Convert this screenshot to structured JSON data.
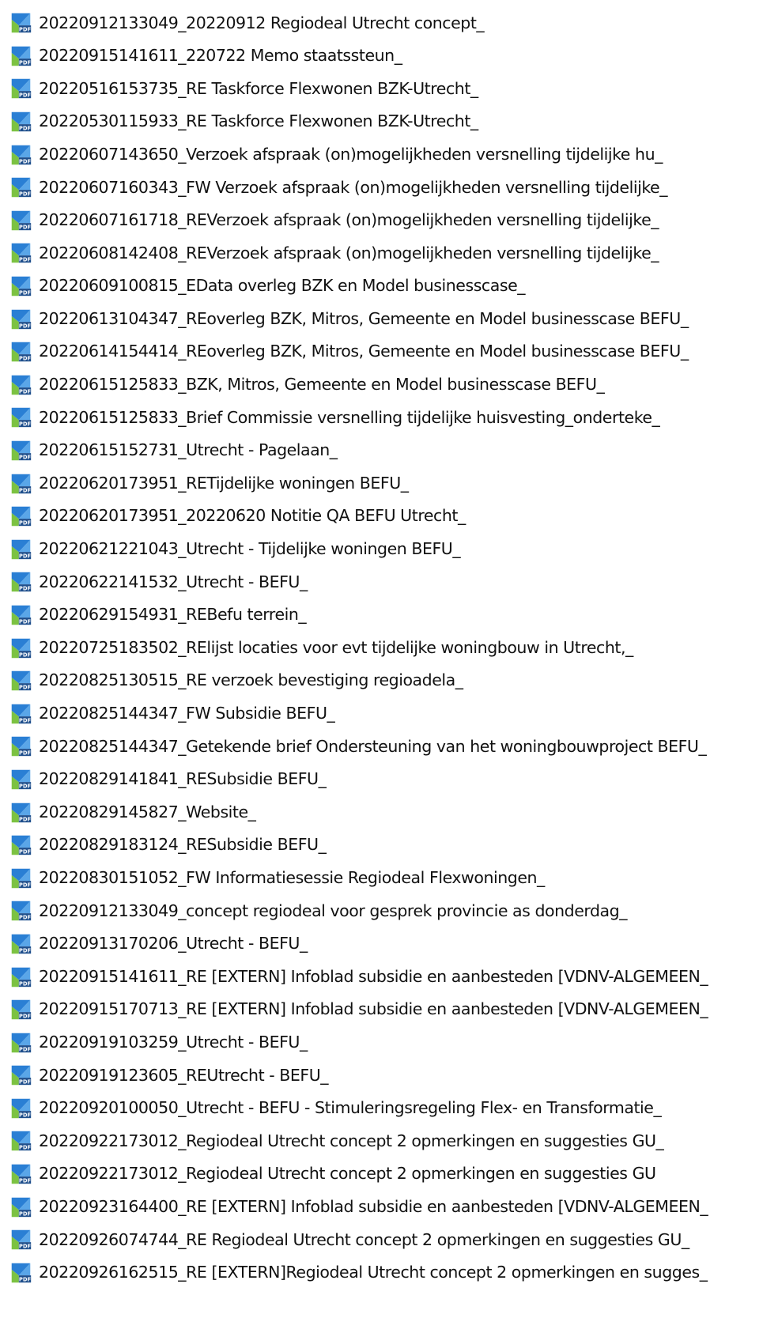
{
  "colors": {
    "icon_blue": "#2a7fd4",
    "icon_green": "#7cc242",
    "icon_dark": "#1f4f8c",
    "text": "#111111",
    "background": "#ffffff"
  },
  "file_icon": "pdf-file-icon",
  "icon_badge_text": "PDF",
  "files": [
    "20220912133049_20220912 Regiodeal Utrecht concept_",
    "20220915141611_220722 Memo staatssteun_",
    "20220516153735_RE Taskforce Flexwonen BZK-Utrecht_",
    "20220530115933_RE Taskforce Flexwonen BZK-Utrecht_",
    "20220607143650_Verzoek afspraak (on)mogelijkheden versnelling tijdelijke hu_",
    "20220607160343_FW Verzoek afspraak (on)mogelijkheden versnelling tijdelijke_",
    "20220607161718_REVerzoek afspraak (on)mogelijkheden versnelling tijdelijke_",
    "20220608142408_REVerzoek afspraak (on)mogelijkheden versnelling tijdelijke_",
    "20220609100815_EData overleg BZK en Model businesscase_",
    "20220613104347_REoverleg BZK, Mitros, Gemeente en Model businesscase BEFU_",
    "20220614154414_REoverleg BZK, Mitros, Gemeente en Model businesscase BEFU_",
    "20220615125833_BZK, Mitros, Gemeente en Model businesscase BEFU_",
    "20220615125833_Brief Commissie versnelling tijdelijke huisvesting_onderteke_",
    "20220615152731_Utrecht - Pagelaan_",
    "20220620173951_RETijdelijke woningen BEFU_",
    "20220620173951_20220620 Notitie QA BEFU Utrecht_",
    "20220621221043_Utrecht - Tijdelijke woningen BEFU_",
    "20220622141532_Utrecht - BEFU_",
    "20220629154931_REBefu terrein_",
    "20220725183502_RElijst locaties voor evt tijdelijke woningbouw in Utrecht,_",
    "20220825130515_RE verzoek bevestiging regioadela_",
    "20220825144347_FW Subsidie BEFU_",
    "20220825144347_Getekende brief Ondersteuning van het woningbouwproject BEFU_",
    "20220829141841_RESubsidie BEFU_",
    "20220829145827_Website_",
    "20220829183124_RESubsidie BEFU_",
    "20220830151052_FW Informatiesessie Regiodeal Flexwoningen_",
    "20220912133049_concept regiodeal voor gesprek provincie as donderdag_",
    "20220913170206_Utrecht - BEFU_",
    "20220915141611_RE [EXTERN] Infoblad subsidie en aanbesteden [VDNV-ALGEMEEN_",
    "20220915170713_RE [EXTERN] Infoblad subsidie en aanbesteden [VDNV-ALGEMEEN_",
    "20220919103259_Utrecht - BEFU_",
    "20220919123605_REUtrecht - BEFU_",
    "20220920100050_Utrecht - BEFU - Stimuleringsregeling Flex- en Transformatie_",
    "20220922173012_Regiodeal Utrecht concept 2 opmerkingen en suggesties GU_",
    "20220922173012_Regiodeal Utrecht concept 2 opmerkingen en suggesties GU",
    "20220923164400_RE [EXTERN] Infoblad subsidie en aanbesteden [VDNV-ALGEMEEN_",
    "20220926074744_RE Regiodeal Utrecht concept 2 opmerkingen en suggesties GU_",
    "20220926162515_RE [EXTERN]Regiodeal Utrecht concept 2 opmerkingen en sugges_"
  ]
}
